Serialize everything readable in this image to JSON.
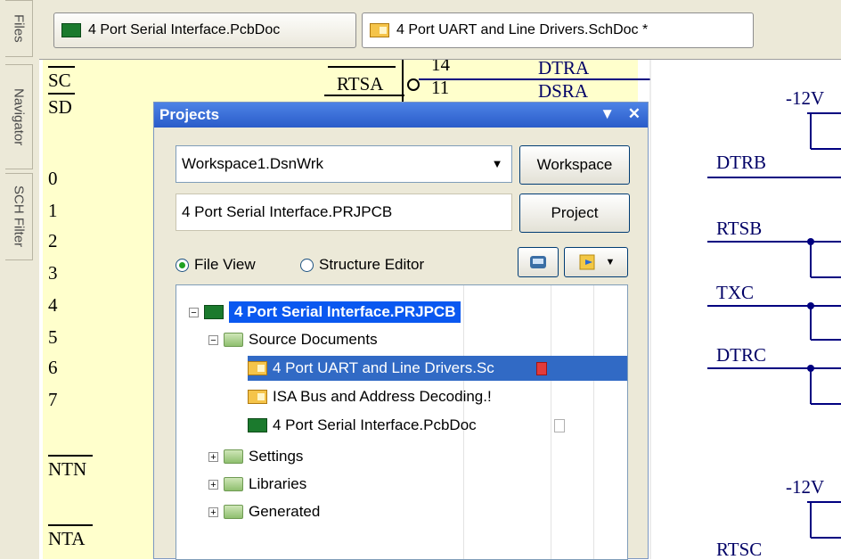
{
  "side_tabs": [
    "Files",
    "Navigator",
    "SCH Filter"
  ],
  "doc_tabs": [
    {
      "label": "4 Port Serial Interface.PcbDoc",
      "icon": "pcb-doc-icon"
    },
    {
      "label": "4 Port UART and Line Drivers.SchDoc *",
      "icon": "sch-doc-icon"
    }
  ],
  "schematic": {
    "left_labels": [
      "SC",
      "SD",
      "0",
      "1",
      "2",
      "3",
      "4",
      "5",
      "6",
      "7",
      "NTN",
      "NTA"
    ],
    "port_label": "RTSA",
    "pin_numbers": [
      "14",
      "11"
    ],
    "nets_top": [
      "DTRA",
      "DSRA"
    ],
    "power": [
      "-12V",
      "-12V"
    ],
    "net_labels": [
      "DTRB",
      "RTSB",
      "TXC",
      "DTRC",
      "RTSC"
    ]
  },
  "projects_panel": {
    "title": "Projects",
    "workspace_value": "Workspace1.DsnWrk",
    "workspace_button": "Workspace",
    "project_value": "4 Port Serial Interface.PRJPCB",
    "project_button": "Project",
    "view_options": {
      "file_view": "File View",
      "structure_editor": "Structure Editor",
      "selected": "File View"
    },
    "tree": {
      "root": "4 Port Serial Interface.PRJPCB",
      "source_folder": "Source Documents",
      "documents": [
        {
          "name": "4 Port UART and Line Drivers.Sc",
          "type": "schematic",
          "modified": true,
          "selected": true
        },
        {
          "name": "ISA Bus and Address Decoding.!",
          "type": "schematic",
          "modified": false,
          "selected": false
        },
        {
          "name": "4 Port Serial Interface.PcbDoc",
          "type": "pcb",
          "modified": false,
          "selected": false
        }
      ],
      "folders": [
        "Settings",
        "Libraries",
        "Generated"
      ]
    }
  },
  "colors": {
    "title_bar": "#2a5cc9",
    "selection": "#316ac5",
    "sheet_yellow": "#ffffcc",
    "wire": "#000080",
    "net_text": "#000066"
  }
}
